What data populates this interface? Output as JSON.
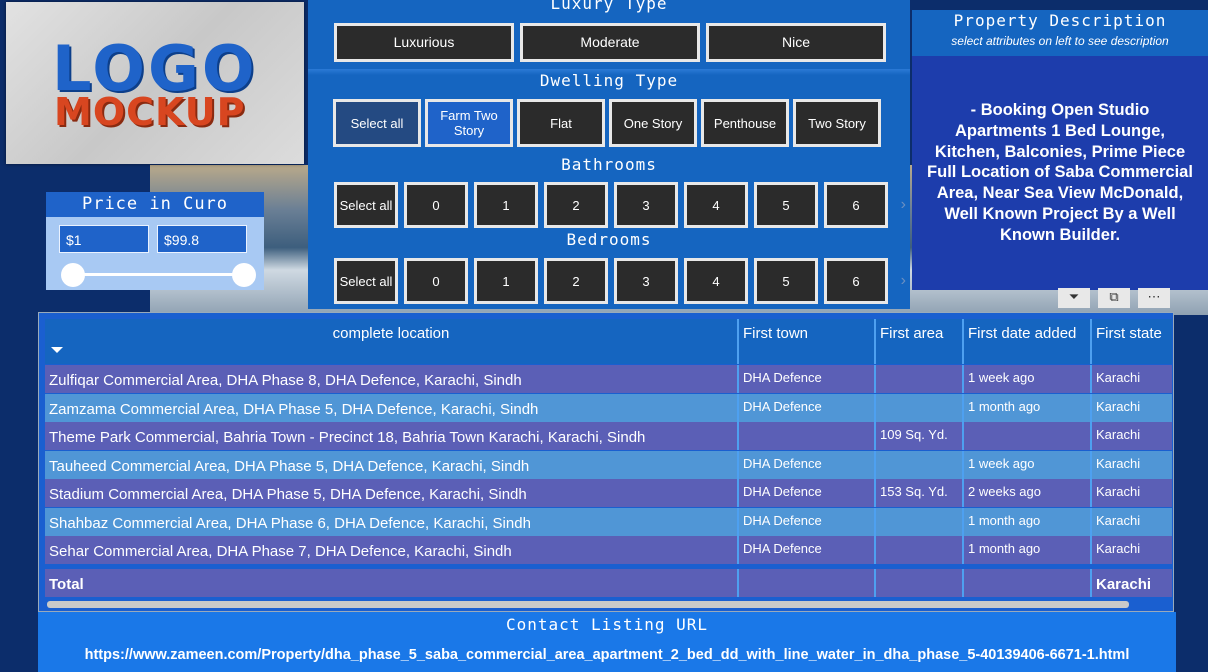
{
  "logo": {
    "line1": "LOGO",
    "line2": "MOCKUP"
  },
  "price": {
    "title": "Price in Curo",
    "min_value": "$1",
    "max_value": "$99.8"
  },
  "slicers": {
    "luxury": {
      "title": "Luxury Type",
      "options": [
        "Luxurious",
        "Moderate",
        "Nice"
      ]
    },
    "dwelling": {
      "title": "Dwelling Type",
      "options": [
        "Select all",
        "Farm Two Story",
        "Flat",
        "One Story",
        "Penthouse",
        "Two Story"
      ]
    },
    "bathrooms": {
      "title": "Bathrooms",
      "options": [
        "Select all",
        "0",
        "1",
        "2",
        "3",
        "4",
        "5",
        "6"
      ]
    },
    "bedrooms": {
      "title": "Bedrooms",
      "options": [
        "Select all",
        "0",
        "1",
        "2",
        "3",
        "4",
        "5",
        "6"
      ]
    }
  },
  "description": {
    "title": "Property Description",
    "subtitle": "select  attributes on left to see description",
    "body": "- Booking Open Studio Apartments 1 Bed Lounge, Kitchen, Balconies, Prime Piece Full Location of Saba Commercial Area, Near Sea View McDonald, Well Known Project By a Well Known Builder."
  },
  "table": {
    "columns": [
      "complete location",
      "First town",
      "First area",
      "First date added",
      "First state"
    ],
    "rows": [
      [
        "Zulfiqar Commercial Area, DHA Phase 8, DHA Defence, Karachi, Sindh",
        "DHA Defence",
        "",
        "1 week ago",
        "Karachi"
      ],
      [
        "Zamzama Commercial Area, DHA Phase 5, DHA Defence, Karachi, Sindh",
        "DHA Defence",
        "",
        "1 month ago",
        "Karachi"
      ],
      [
        "Theme Park Commercial, Bahria Town - Precinct 18, Bahria Town Karachi, Karachi, Sindh",
        "",
        "109 Sq. Yd.",
        "",
        "Karachi"
      ],
      [
        "Tauheed Commercial Area, DHA Phase 5, DHA Defence, Karachi, Sindh",
        "DHA Defence",
        "",
        "1 week ago",
        "Karachi"
      ],
      [
        "Stadium Commercial Area, DHA Phase 5, DHA Defence, Karachi, Sindh",
        "DHA Defence",
        "153 Sq. Yd.",
        "2 weeks ago",
        "Karachi"
      ],
      [
        "Shahbaz Commercial Area, DHA Phase 6, DHA Defence, Karachi, Sindh",
        "DHA Defence",
        "",
        "1 month ago",
        "Karachi"
      ],
      [
        "Sehar Commercial Area, DHA Phase 7, DHA Defence, Karachi, Sindh",
        "DHA Defence",
        "",
        "1 month ago",
        "Karachi"
      ]
    ],
    "total": {
      "label": "Total",
      "state": "Karachi"
    }
  },
  "contact": {
    "title": "Contact Listing URL",
    "url": "https://www.zameen.com/Property/dha_phase_5_saba_commercial_area_apartment_2_bed_dd_with_line_water_in_dha_phase_5-40139406-6671-1.html"
  }
}
